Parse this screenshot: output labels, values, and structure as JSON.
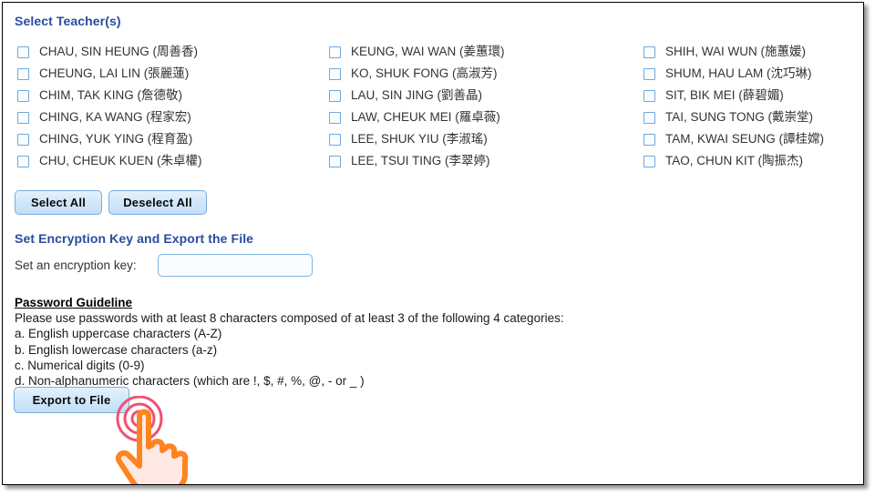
{
  "page": {
    "title": "Select Teacher(s)"
  },
  "teacher_section": {
    "heading": "Select Teacher(s)",
    "columns": [
      {
        "items": [
          {
            "label": "CHAU, SIN HEUNG (周善香)",
            "checked": false
          },
          {
            "label": "CHEUNG, LAI LIN (張麗蓮)",
            "checked": false
          },
          {
            "label": "CHIM, TAK KING (詹德敬)",
            "checked": false
          },
          {
            "label": "CHING, KA WANG (程家宏)",
            "checked": false
          },
          {
            "label": "CHING, YUK YING (程育盈)",
            "checked": false
          },
          {
            "label": "CHU, CHEUK KUEN (朱卓權)",
            "checked": false
          }
        ]
      },
      {
        "items": [
          {
            "label": "KEUNG, WAI WAN (姜蕙環)",
            "checked": false
          },
          {
            "label": "KO, SHUK FONG (高淑芳)",
            "checked": false
          },
          {
            "label": "LAU, SIN JING (劉善晶)",
            "checked": false
          },
          {
            "label": "LAW, CHEUK MEI (羅卓薇)",
            "checked": false
          },
          {
            "label": "LEE, SHUK YIU (李淑瑤)",
            "checked": false
          },
          {
            "label": "LEE, TSUI TING (李翠婷)",
            "checked": false
          }
        ]
      },
      {
        "items": [
          {
            "label": "SHIH, WAI WUN (施蕙媛)",
            "checked": false
          },
          {
            "label": "SHUM, HAU LAM (沈巧琳)",
            "checked": false
          },
          {
            "label": "SIT, BIK MEI (薛碧媚)",
            "checked": false
          },
          {
            "label": "TAI, SUNG TONG (戴崇堂)",
            "checked": false
          },
          {
            "label": "TAM, KWAI SEUNG (譚桂嫦)",
            "checked": false
          },
          {
            "label": "TAO, CHUN KIT (陶振杰)",
            "checked": false
          }
        ]
      }
    ],
    "select_all_label": "Select All",
    "deselect_all_label": "Deselect All"
  },
  "encryption_section": {
    "heading": "Set Encryption Key and Export the File",
    "key_label": "Set an encryption key:",
    "key_value": "",
    "key_placeholder": "",
    "export_label": "Export to File"
  },
  "password_guideline": {
    "heading": "Password Guideline",
    "intro": "Please use passwords with at least 8 characters composed of at least 3 of the following 4 categories:",
    "rules": [
      "a. English uppercase characters (A-Z)",
      "b. English lowercase characters (a-z)",
      "c. Numerical digits (0-9)",
      "d. Non-alphanumeric characters (which are !, $, #, %, @, - or _ )"
    ]
  },
  "cursor": {
    "icon": "tap-hand-icon",
    "hand_color": "#FF8420",
    "hand_fill": "#FDE8E4",
    "ripple_color": "#F25070"
  },
  "colors": {
    "heading_blue": "#2B4BA0",
    "checkbox_border": "#6FA8DC",
    "button_border": "#7AAEDC",
    "button_fill": "#CFE6F9",
    "input_border": "#7FB3E0",
    "text": "#333333",
    "frame_border": "#000000"
  }
}
